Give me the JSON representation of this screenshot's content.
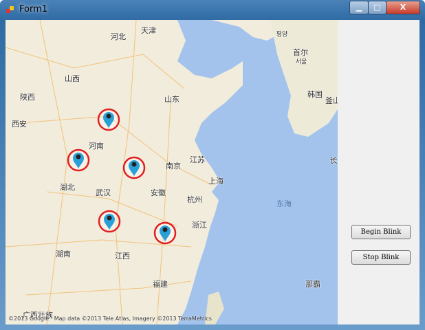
{
  "window": {
    "title": "Form1",
    "minimize": "▁",
    "maximize": "□",
    "close": "X"
  },
  "map": {
    "copyright": "©2013 Google · Map data ©2013 Tele Atlas, Imagery ©2013 TerraMetrics",
    "labels": [
      "天津",
      "河北",
      "山西",
      "陕西",
      "山东",
      "西安",
      "河南",
      "江苏",
      "南京",
      "湖北",
      "武汉",
      "安徽",
      "上海",
      "杭州",
      "浙江",
      "东海",
      "湖南",
      "江西",
      "福建",
      "首尔",
      "韩国",
      "釜山",
      "长",
      "那霸",
      "广西壮族",
      "평양",
      "서울"
    ],
    "marker_count": 5,
    "colors": {
      "land": "#f1ecdc",
      "sea": "#a3c3ec",
      "marker": "#2aa0d8",
      "ring": "#e02020"
    }
  },
  "buttons": {
    "begin": "Begin Blink",
    "stop": "Stop Blink"
  }
}
